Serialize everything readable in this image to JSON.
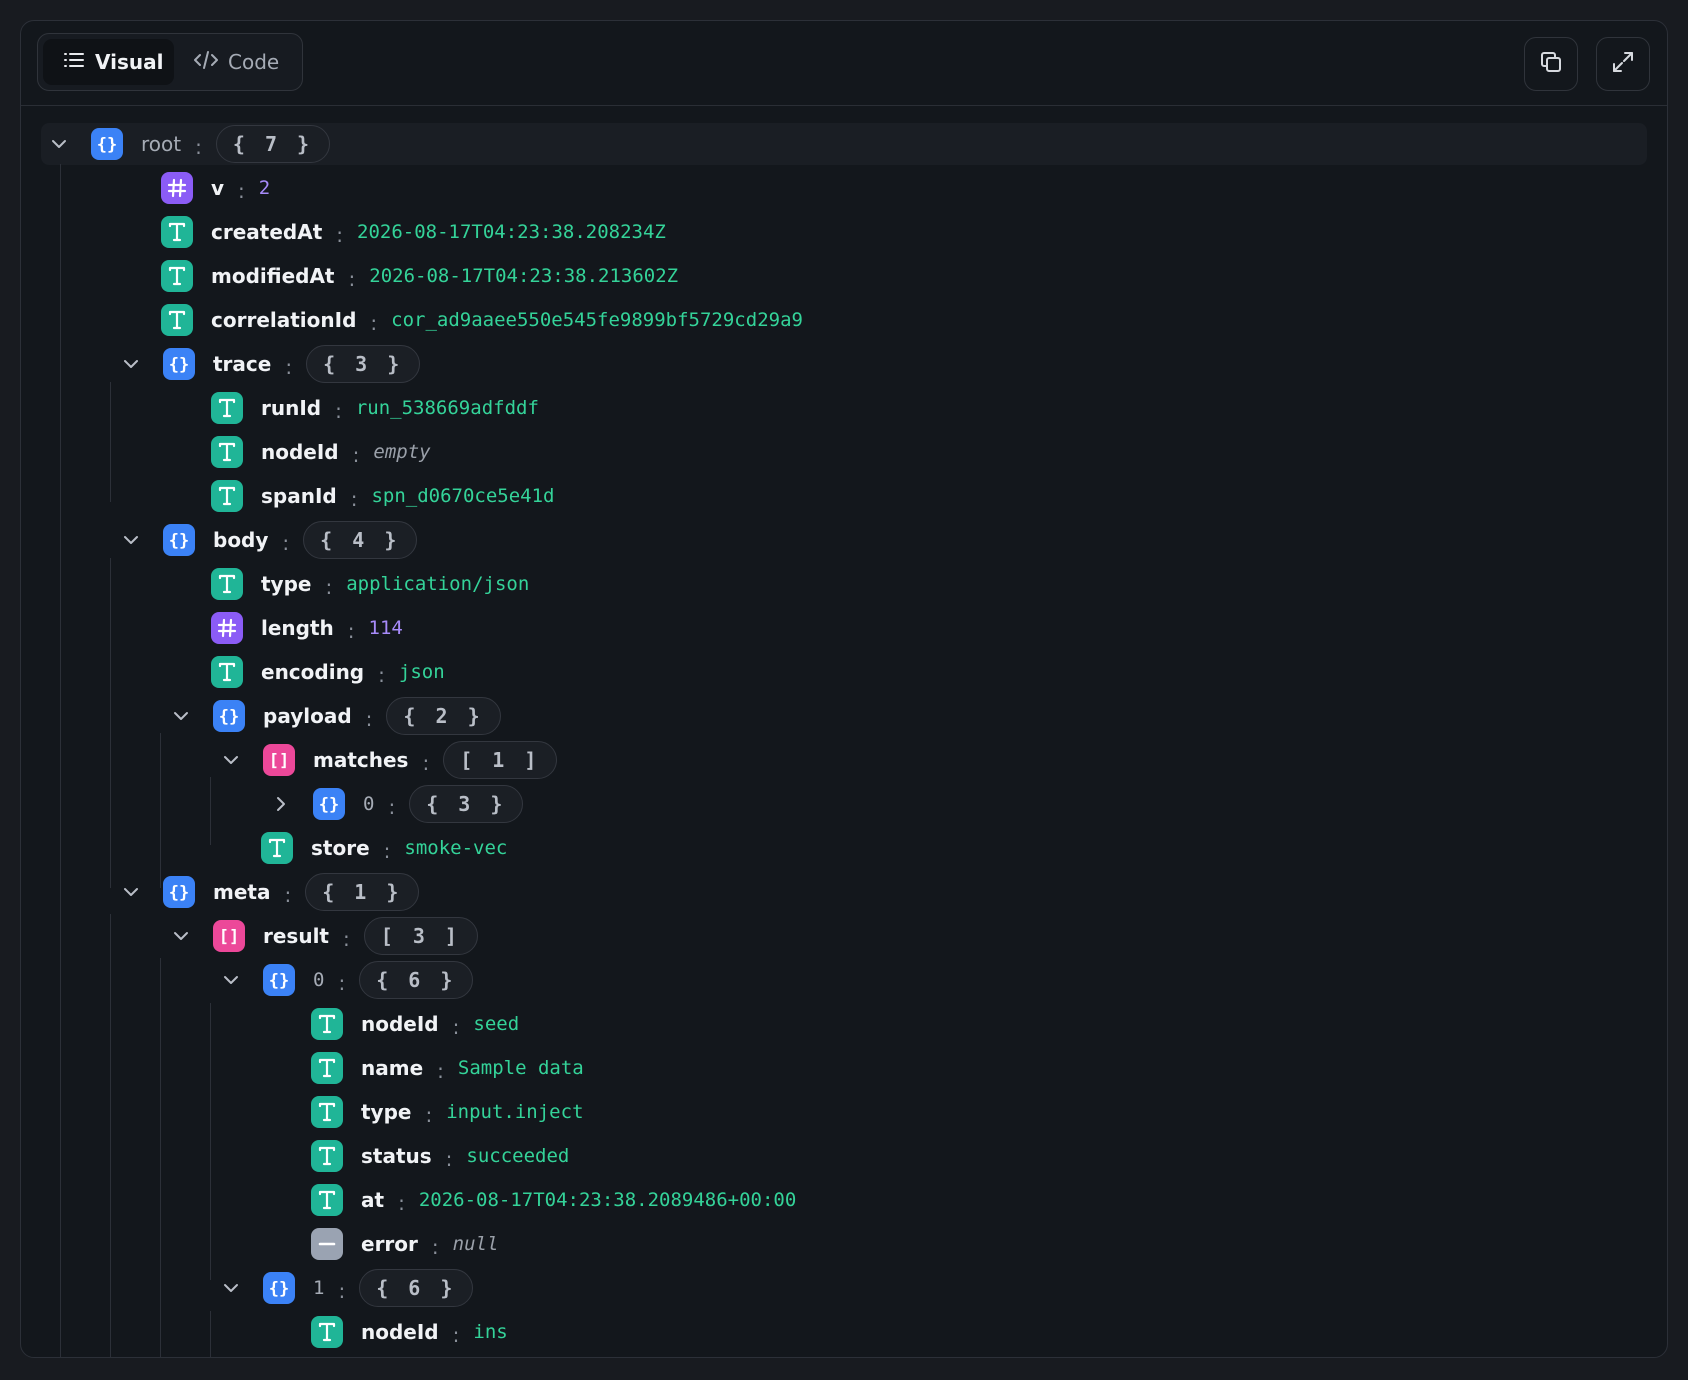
{
  "toolbar": {
    "tabs": [
      {
        "label": "Visual",
        "icon": "list-icon",
        "active": true
      },
      {
        "label": "Code",
        "icon": "code-icon",
        "active": false
      }
    ],
    "actions": [
      {
        "name": "copy-button",
        "icon": "copy-icon"
      },
      {
        "name": "expand-button",
        "icon": "expand-icon"
      }
    ]
  },
  "tree": {
    "root": {
      "key": "root",
      "count": "{ 7 }"
    },
    "v": {
      "key": "v",
      "value": "2"
    },
    "createdAt": {
      "key": "createdAt",
      "value": "2026-08-17T04:23:38.208234Z"
    },
    "modifiedAt": {
      "key": "modifiedAt",
      "value": "2026-08-17T04:23:38.213602Z"
    },
    "correlationId": {
      "key": "correlationId",
      "value": "cor_ad9aaee550e545fe9899bf5729cd29a9"
    },
    "trace": {
      "key": "trace",
      "count": "{ 3 }",
      "runId": {
        "key": "runId",
        "value": "run_538669adfddf"
      },
      "nodeId": {
        "key": "nodeId",
        "value": "empty"
      },
      "spanId": {
        "key": "spanId",
        "value": "spn_d0670ce5e41d"
      }
    },
    "body": {
      "key": "body",
      "count": "{ 4 }",
      "type": {
        "key": "type",
        "value": "application/json"
      },
      "length": {
        "key": "length",
        "value": "114"
      },
      "encoding": {
        "key": "encoding",
        "value": "json"
      },
      "payload": {
        "key": "payload",
        "count": "{ 2 }",
        "matches": {
          "key": "matches",
          "count": "[ 1 ]"
        },
        "match0": {
          "key": "0",
          "count": "{ 3 }"
        },
        "store": {
          "key": "store",
          "value": "smoke-vec"
        }
      }
    },
    "meta": {
      "key": "meta",
      "count": "{ 1 }",
      "result": {
        "key": "result",
        "count": "[ 3 ]"
      },
      "item0": {
        "key": "0",
        "count": "{ 6 }",
        "nodeId": {
          "key": "nodeId",
          "value": "seed"
        },
        "name": {
          "key": "name",
          "value": "Sample data"
        },
        "type": {
          "key": "type",
          "value": "input.inject"
        },
        "status": {
          "key": "status",
          "value": "succeeded"
        },
        "at": {
          "key": "at",
          "value": "2026-08-17T04:23:38.2089486+00:00"
        },
        "error": {
          "key": "error",
          "value": "null"
        }
      },
      "item1": {
        "key": "1",
        "count": "{ 6 }",
        "nodeId": {
          "key": "nodeId",
          "value": "ins"
        }
      }
    }
  },
  "colors": {
    "string_icon": "#20b597",
    "number_icon": "#8b5cf6",
    "object_icon": "#3b82f6",
    "array_icon": "#ec4899",
    "null_icon": "#9aa3b2",
    "string_value": "#34d399",
    "number_value": "#a78bfa"
  }
}
